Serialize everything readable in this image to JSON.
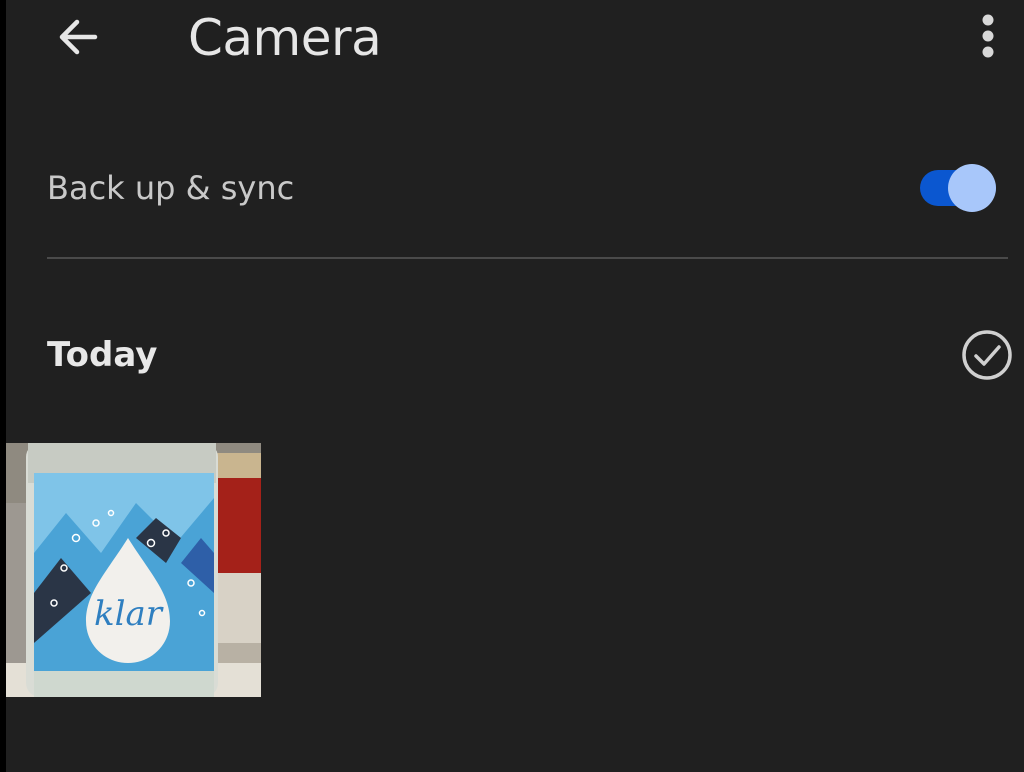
{
  "app_bar": {
    "back_icon": "arrow-back-icon",
    "title": "Camera",
    "more_icon": "more-vert-icon"
  },
  "sync": {
    "label": "Back up & sync",
    "enabled": true,
    "accent_color": "#0b57d0",
    "thumb_color": "#a8c7fa"
  },
  "section": {
    "title": "Today",
    "select_icon": "check-circle-icon"
  },
  "photos": [
    {
      "label_text": "klar",
      "icon": "photo-thumbnail"
    }
  ],
  "colors": {
    "background": "#202020",
    "text_primary": "#e8e8e8",
    "text_secondary": "#c9c9c9",
    "divider": "#4a4a4a"
  }
}
